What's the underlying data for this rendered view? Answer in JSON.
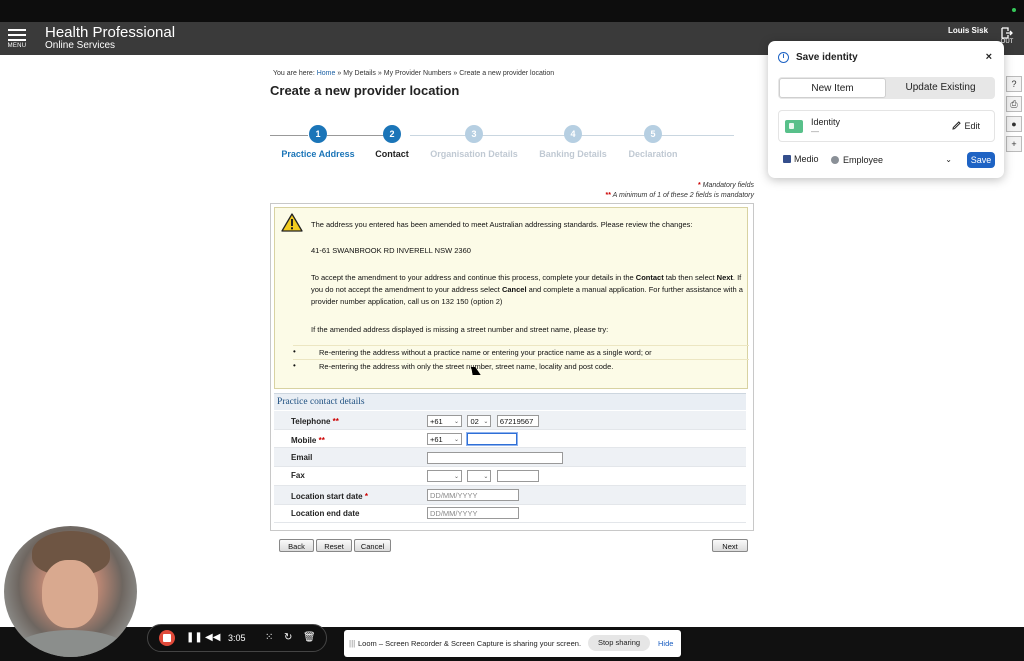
{
  "header": {
    "menu_label": "MENU",
    "brand_line1": "Health Professional",
    "brand_line2": "Online Services",
    "user_name": "Louis Sisk",
    "logout_label": "OUT"
  },
  "breadcrumb": {
    "prefix": "You are here:",
    "home": "Home",
    "item1": "My Details",
    "item2": "My Provider Numbers",
    "current": "Create a new provider location",
    "separator": "»"
  },
  "page_title": "Create a new provider location",
  "stepper": {
    "steps": [
      {
        "number": "1",
        "label": "Practice Address",
        "state": "done"
      },
      {
        "number": "2",
        "label": "Contact",
        "state": "current"
      },
      {
        "number": "3",
        "label": "Organisation Details",
        "state": "future"
      },
      {
        "number": "4",
        "label": "Banking Details",
        "state": "future"
      },
      {
        "number": "5",
        "label": "Declaration",
        "state": "future"
      }
    ]
  },
  "mandatory": {
    "star1": "*",
    "text1": "Mandatory fields",
    "star2": "**",
    "text2": "A minimum of 1 of these 2 fields is mandatory"
  },
  "alert": {
    "line1": "The address you entered has been amended to meet Australian addressing standards. Please review the changes:",
    "address": "41-61 SWANBROOK RD INVERELL NSW 2360",
    "para2_a": "To accept the amendment to your address and continue this process, complete your details in the ",
    "para2_b": "Contact",
    "para2_c": " tab then select ",
    "para2_d": "Next",
    "para2_e": ". If you do not accept the amendment to your address select ",
    "para2_f": "Cancel",
    "para2_g": " and complete a manual application. For further assistance with a provider number application, call us on 132 150 (option 2)",
    "para3": "If the amended address displayed is missing a street number and street name, please try:",
    "bullets": [
      "Re-entering the address without a practice name or entering your practice name as a single word; or",
      "Re-entering the address with only the street number, street name, locality and post code."
    ],
    "bullet_char": "•"
  },
  "contact": {
    "heading": "Practice contact details",
    "telephone": {
      "label": "Telephone",
      "marker": "**",
      "country": "+61",
      "area": "02",
      "number": "67219567"
    },
    "mobile": {
      "label": "Mobile",
      "marker": "**",
      "country": "+61",
      "number": ""
    },
    "email": {
      "label": "Email",
      "value": ""
    },
    "fax": {
      "label": "Fax",
      "country": "",
      "area": "",
      "number": ""
    },
    "start_date": {
      "label": "Location start date",
      "marker": "*",
      "placeholder": "DD/MM/YYYY"
    },
    "end_date": {
      "label": "Location end date",
      "placeholder": "DD/MM/YYYY"
    }
  },
  "buttons": {
    "back": "Back",
    "reset": "Reset",
    "cancel": "Cancel",
    "next": "Next"
  },
  "popup": {
    "title": "Save identity",
    "info_icon": "i",
    "close": "×",
    "tab_new": "New Item",
    "tab_update": "Update Existing",
    "item_name": "Identity",
    "item_sub": "—",
    "edit": "Edit",
    "vault": "Medio",
    "collection": "Employee",
    "save": "Save"
  },
  "side_tools": [
    "?",
    "⎙",
    "●",
    "+"
  ],
  "recorder": {
    "time": "3:05"
  },
  "loom": {
    "grip": "|||",
    "message": "Loom – Screen Recorder & Screen Capture is sharing your screen.",
    "stop": "Stop sharing",
    "hide": "Hide"
  },
  "colors": {
    "accent": "#1b75b8",
    "header_bg": "#3a3a3a",
    "alert_bg": "#fcfbe7",
    "save_blue": "#1e63c4",
    "record_red": "#e04a3a"
  }
}
